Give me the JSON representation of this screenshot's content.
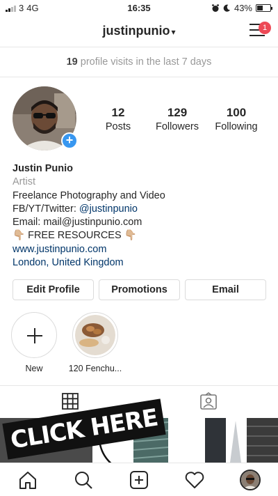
{
  "status_bar": {
    "carrier": "3",
    "network": "4G",
    "time": "16:35",
    "battery": "43%",
    "battery_level": 0.43
  },
  "header": {
    "username": "justinpunio",
    "menu_icon": "hamburger-icon",
    "notification_count": "1"
  },
  "profile_visits": {
    "count": "19",
    "text": "profile visits in the last 7 days"
  },
  "stats": [
    {
      "value": "12",
      "label": "Posts"
    },
    {
      "value": "129",
      "label": "Followers"
    },
    {
      "value": "100",
      "label": "Following"
    }
  ],
  "bio": {
    "name": "Justin Punio",
    "category": "Artist",
    "line1": "Freelance Photography and Video",
    "line2": "FB/YT/Twitter: @justinpunio",
    "line3": "Email: mail@justinpunio.com",
    "line4": "👇🏼 FREE RESOURCES 👇🏼",
    "website": "www.justinpunio.com",
    "location": "London, United Kingdom"
  },
  "buttons": {
    "edit_profile": "Edit Profile",
    "promotions": "Promotions",
    "email": "Email"
  },
  "highlights": [
    {
      "label": "New"
    },
    {
      "label": "120 Fenchu..."
    }
  ],
  "banner": {
    "text": "CLICK HERE"
  },
  "colors": {
    "link": "#003569",
    "notification": "#ed4956",
    "add_story": "#3897f0"
  }
}
